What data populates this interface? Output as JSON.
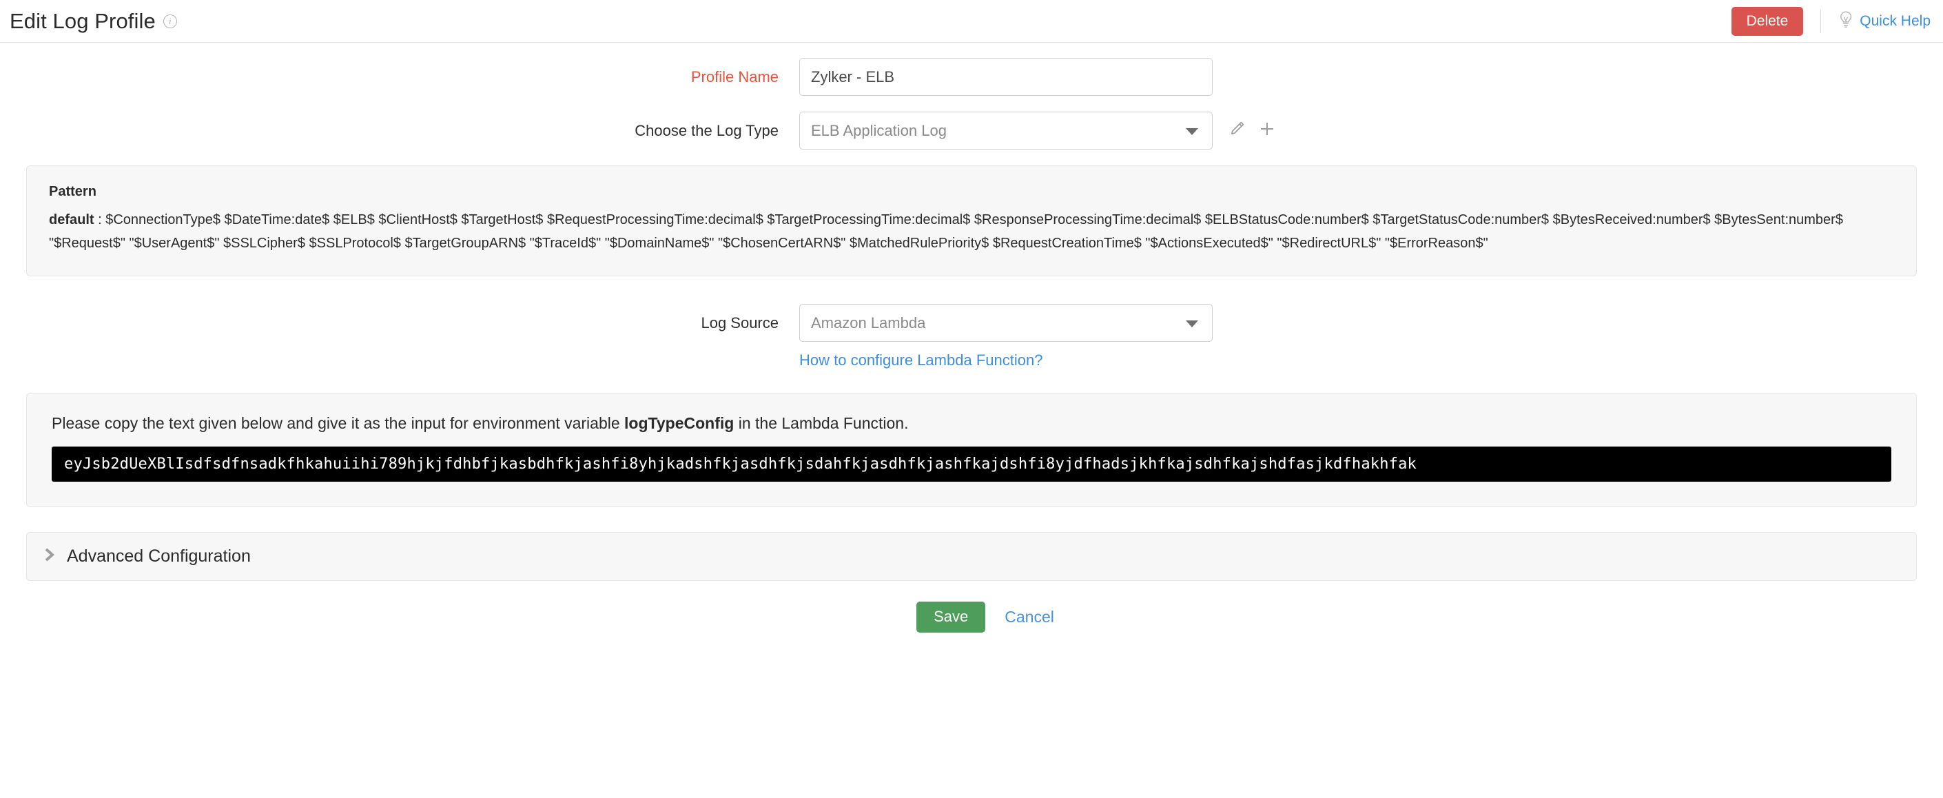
{
  "header": {
    "title": "Edit Log Profile",
    "info_icon": "info-icon",
    "delete_label": "Delete",
    "quick_help_label": "Quick Help",
    "quick_help_icon": "lightbulb-icon",
    "delete_color": "#d9534f",
    "link_color": "#3c8dde"
  },
  "form": {
    "profile_name": {
      "label": "Profile Name",
      "value": "Zylker - ELB",
      "required": true,
      "label_color": "#e0563e"
    },
    "log_type": {
      "label": "Choose the Log Type",
      "value": "ELB Application Log",
      "edit_icon": "pencil-icon",
      "add_icon": "plus-icon"
    },
    "log_source": {
      "label": "Log Source",
      "value": "Amazon Lambda",
      "helper_link": "How to configure Lambda Function?"
    }
  },
  "pattern": {
    "title": "Pattern",
    "key": "default",
    "separator": " : ",
    "value": "$ConnectionType$ $DateTime:date$ $ELB$ $ClientHost$ $TargetHost$ $RequestProcessingTime:decimal$ $TargetProcessingTime:decimal$ $ResponseProcessingTime:decimal$ $ELBStatusCode:number$ $TargetStatusCode:number$ $BytesReceived:number$ $BytesSent:number$ \"$Request$\" \"$UserAgent$\" $SSLCipher$ $SSLProtocol$ $TargetGroupARN$ \"$TraceId$\" \"$DomainName$\" \"$ChosenCertARN$\" $MatchedRulePriority$ $RequestCreationTime$ \"$ActionsExecuted$\" \"$RedirectURL$\" \"$ErrorReason$\""
  },
  "lambda": {
    "note_prefix": "Please copy the text given below and give it as the input for environment variable ",
    "note_variable": "logTypeConfig",
    "note_suffix": " in the Lambda Function.",
    "code": "eyJsb2dUeXBlIsdfsdfnsadkfhkahuiihi789hjkjfdhbfjkasbdhfkjashfi8yhjkadshfkjasdhfkjsdahfkjasdhfkjashfkajdshfi8yjdfhadsjkhfkajsdhfkajshdfasjkdfhakhfak"
  },
  "advanced": {
    "label": "Advanced Configuration",
    "chevron_icon": "chevron-right-icon",
    "expanded": false
  },
  "footer": {
    "save_label": "Save",
    "cancel_label": "Cancel",
    "save_color": "#4f9d5b",
    "cancel_color": "#4a90d9"
  }
}
